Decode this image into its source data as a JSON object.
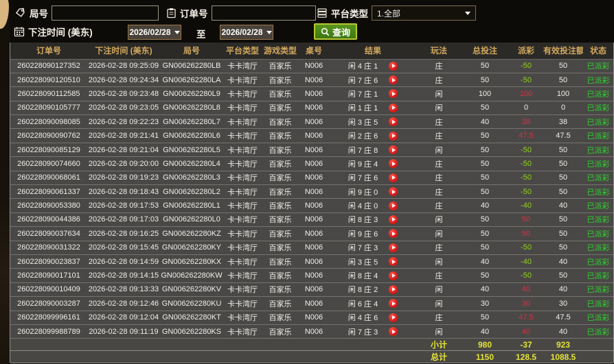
{
  "colors": {
    "accent_gold": "#d2a85e",
    "win_red": "#d63045",
    "loss_green": "#93d41f",
    "paid_green": "#2fd42f",
    "summary_yellow": "#e4e436",
    "button_green": "#3d7612"
  },
  "filters": {
    "game_no_label": "局号",
    "order_no_label": "订单号",
    "platform_type_label": "平台类型",
    "platform_type_value": "1.全部",
    "bet_time_label": "下注时间 (美东)",
    "date_from": "2026/02/28",
    "to_label": "至",
    "date_to": "2026/02/28",
    "search_label": "查询"
  },
  "table": {
    "headers": [
      "订单号",
      "下注时间 (美东)",
      "局号",
      "平台类型",
      "游戏类型",
      "桌号",
      "结果",
      "玩法",
      "总投注",
      "派彩",
      "有效投注额",
      "状态"
    ],
    "rows": [
      {
        "order": "260228090127352",
        "time": "2026-02-28 09:25:09",
        "game": "GN006262280LB",
        "hall": "卡卡湾厅",
        "type": "百家乐",
        "tbl": "N006",
        "result": "闲 4 庄 1",
        "play": "庄",
        "bet": "50",
        "payout": "-50",
        "pc": "g",
        "valid": "50",
        "status": "已派彩"
      },
      {
        "order": "260228090120510",
        "time": "2026-02-28 09:24:34",
        "game": "GN006262280LA",
        "hall": "卡卡湾厅",
        "type": "百家乐",
        "tbl": "N006",
        "result": "闲 7 庄 6",
        "play": "庄",
        "bet": "50",
        "payout": "-50",
        "pc": "g",
        "valid": "50",
        "status": "已派彩"
      },
      {
        "order": "260228090112585",
        "time": "2026-02-28 09:23:48",
        "game": "GN006262280L9",
        "hall": "卡卡湾厅",
        "type": "百家乐",
        "tbl": "N006",
        "result": "闲 7 庄 1",
        "play": "闲",
        "bet": "100",
        "payout": "100",
        "pc": "r",
        "valid": "100",
        "status": "已派彩"
      },
      {
        "order": "260228090105777",
        "time": "2026-02-28 09:23:05",
        "game": "GN006262280L8",
        "hall": "卡卡湾厅",
        "type": "百家乐",
        "tbl": "N006",
        "result": "闲 1 庄 1",
        "play": "闲",
        "bet": "50",
        "payout": "0",
        "pc": "w",
        "valid": "0",
        "status": "已派彩"
      },
      {
        "order": "260228090098085",
        "time": "2026-02-28 09:22:23",
        "game": "GN006262280L7",
        "hall": "卡卡湾厅",
        "type": "百家乐",
        "tbl": "N006",
        "result": "闲 3 庄 5",
        "play": "庄",
        "bet": "40",
        "payout": "38",
        "pc": "r",
        "valid": "38",
        "status": "已派彩"
      },
      {
        "order": "260228090090762",
        "time": "2026-02-28 09:21:41",
        "game": "GN006262280L6",
        "hall": "卡卡湾厅",
        "type": "百家乐",
        "tbl": "N006",
        "result": "闲 2 庄 6",
        "play": "庄",
        "bet": "50",
        "payout": "47.5",
        "pc": "r",
        "valid": "47.5",
        "status": "已派彩"
      },
      {
        "order": "260228090085129",
        "time": "2026-02-28 09:21:04",
        "game": "GN006262280L5",
        "hall": "卡卡湾厅",
        "type": "百家乐",
        "tbl": "N006",
        "result": "闲 7 庄 8",
        "play": "闲",
        "bet": "50",
        "payout": "-50",
        "pc": "g",
        "valid": "50",
        "status": "已派彩"
      },
      {
        "order": "260228090074660",
        "time": "2026-02-28 09:20:00",
        "game": "GN006262280L4",
        "hall": "卡卡湾厅",
        "type": "百家乐",
        "tbl": "N006",
        "result": "闲 9 庄 4",
        "play": "庄",
        "bet": "50",
        "payout": "-50",
        "pc": "g",
        "valid": "50",
        "status": "已派彩"
      },
      {
        "order": "260228090068061",
        "time": "2026-02-28 09:19:23",
        "game": "GN006262280L3",
        "hall": "卡卡湾厅",
        "type": "百家乐",
        "tbl": "N006",
        "result": "闲 7 庄 6",
        "play": "庄",
        "bet": "50",
        "payout": "-50",
        "pc": "g",
        "valid": "50",
        "status": "已派彩"
      },
      {
        "order": "260228090061337",
        "time": "2026-02-28 09:18:43",
        "game": "GN006262280L2",
        "hall": "卡卡湾厅",
        "type": "百家乐",
        "tbl": "N006",
        "result": "闲 9 庄 0",
        "play": "庄",
        "bet": "50",
        "payout": "-50",
        "pc": "g",
        "valid": "50",
        "status": "已派彩"
      },
      {
        "order": "260228090053380",
        "time": "2026-02-28 09:17:53",
        "game": "GN006262280L1",
        "hall": "卡卡湾厅",
        "type": "百家乐",
        "tbl": "N006",
        "result": "闲 4 庄 0",
        "play": "庄",
        "bet": "40",
        "payout": "-40",
        "pc": "g",
        "valid": "40",
        "status": "已派彩"
      },
      {
        "order": "260228090044386",
        "time": "2026-02-28 09:17:03",
        "game": "GN006262280L0",
        "hall": "卡卡湾厅",
        "type": "百家乐",
        "tbl": "N006",
        "result": "闲 8 庄 3",
        "play": "闲",
        "bet": "50",
        "payout": "50",
        "pc": "r",
        "valid": "50",
        "status": "已派彩"
      },
      {
        "order": "260228090037634",
        "time": "2026-02-28 09:16:25",
        "game": "GN006262280KZ",
        "hall": "卡卡湾厅",
        "type": "百家乐",
        "tbl": "N006",
        "result": "闲 9 庄 6",
        "play": "闲",
        "bet": "50",
        "payout": "50",
        "pc": "r",
        "valid": "50",
        "status": "已派彩"
      },
      {
        "order": "260228090031322",
        "time": "2026-02-28 09:15:45",
        "game": "GN006262280KY",
        "hall": "卡卡湾厅",
        "type": "百家乐",
        "tbl": "N006",
        "result": "闲 7 庄 3",
        "play": "庄",
        "bet": "50",
        "payout": "-50",
        "pc": "g",
        "valid": "50",
        "status": "已派彩"
      },
      {
        "order": "260228090023837",
        "time": "2026-02-28 09:14:59",
        "game": "GN006262280KX",
        "hall": "卡卡湾厅",
        "type": "百家乐",
        "tbl": "N006",
        "result": "闲 3 庄 5",
        "play": "闲",
        "bet": "40",
        "payout": "-40",
        "pc": "g",
        "valid": "40",
        "status": "已派彩"
      },
      {
        "order": "260228090017101",
        "time": "2026-02-28 09:14:15",
        "game": "GN006262280KW",
        "hall": "卡卡湾厅",
        "type": "百家乐",
        "tbl": "N006",
        "result": "闲 8 庄 4",
        "play": "庄",
        "bet": "50",
        "payout": "-50",
        "pc": "g",
        "valid": "50",
        "status": "已派彩"
      },
      {
        "order": "260228090010409",
        "time": "2026-02-28 09:13:33",
        "game": "GN006262280KV",
        "hall": "卡卡湾厅",
        "type": "百家乐",
        "tbl": "N006",
        "result": "闲 8 庄 2",
        "play": "闲",
        "bet": "40",
        "payout": "40",
        "pc": "r",
        "valid": "40",
        "status": "已派彩"
      },
      {
        "order": "260228090003287",
        "time": "2026-02-28 09:12:46",
        "game": "GN006262280KU",
        "hall": "卡卡湾厅",
        "type": "百家乐",
        "tbl": "N006",
        "result": "闲 6 庄 4",
        "play": "闲",
        "bet": "30",
        "payout": "30",
        "pc": "r",
        "valid": "30",
        "status": "已派彩"
      },
      {
        "order": "260228099996161",
        "time": "2026-02-28 09:12:04",
        "game": "GN006262280KT",
        "hall": "卡卡湾厅",
        "type": "百家乐",
        "tbl": "N006",
        "result": "闲 4 庄 6",
        "play": "庄",
        "bet": "50",
        "payout": "47.5",
        "pc": "r",
        "valid": "47.5",
        "status": "已派彩"
      },
      {
        "order": "260228099988789",
        "time": "2026-02-28 09:11:19",
        "game": "GN006262280KS",
        "hall": "卡卡湾厅",
        "type": "百家乐",
        "tbl": "N006",
        "result": "闲 7 庄 3",
        "play": "闲",
        "bet": "40",
        "payout": "40",
        "pc": "r",
        "valid": "40",
        "status": "已派彩"
      }
    ],
    "summary": [
      {
        "label": "小计",
        "bet": "980",
        "payout": "-37",
        "valid": "923"
      },
      {
        "label": "总计",
        "bet": "1150",
        "payout": "128.5",
        "valid": "1088.5"
      }
    ]
  }
}
